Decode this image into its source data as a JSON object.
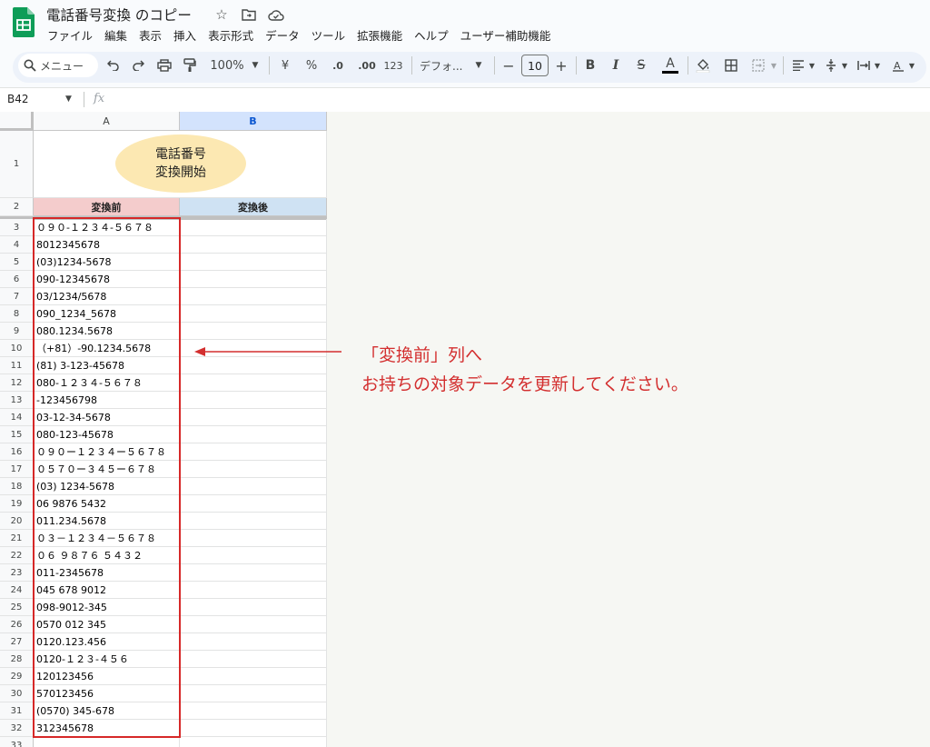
{
  "app": {
    "title": "電話番号変換 のコピー",
    "star_icon": "star-icon",
    "folder_icon": "move-folder-icon",
    "cloud_icon": "cloud-status-icon"
  },
  "menu": [
    "ファイル",
    "編集",
    "表示",
    "挿入",
    "表示形式",
    "データ",
    "ツール",
    "拡張機能",
    "ヘルプ",
    "ユーザー補助機能"
  ],
  "toolbar": {
    "search_label": "メニュー",
    "zoom": "100%",
    "currency": "¥",
    "percent": "%",
    "decrease_decimal": ".0",
    "increase_decimal": ".00",
    "number_format": "123",
    "font": "デフォ...",
    "font_size": "10",
    "minus": "−",
    "plus": "+",
    "bold": "B",
    "italic": "I",
    "strike": "S",
    "text_color": "A"
  },
  "formula_bar": {
    "name_box": "B42",
    "fx": "fx",
    "value": ""
  },
  "columns": [
    "A",
    "B"
  ],
  "header_row": {
    "before": "変換前",
    "after": "変換後"
  },
  "start_button": {
    "line1": "電話番号",
    "line2": "変換開始"
  },
  "rows": [
    {
      "n": "1",
      "a": ""
    },
    {
      "n": "2",
      "a": ""
    },
    {
      "n": "3",
      "a": "０９０-１２３４-５６７８"
    },
    {
      "n": "4",
      "a": "8012345678"
    },
    {
      "n": "5",
      "a": "(03)1234-5678"
    },
    {
      "n": "6",
      "a": "090-12345678"
    },
    {
      "n": "7",
      "a": "03/1234/5678"
    },
    {
      "n": "8",
      "a": "090_1234_5678"
    },
    {
      "n": "9",
      "a": "080.1234.5678"
    },
    {
      "n": "10",
      "a": "（+81）-90.1234.5678"
    },
    {
      "n": "11",
      "a": "(81) 3-123-45678"
    },
    {
      "n": "12",
      "a": "080-１２３４-５６７８"
    },
    {
      "n": "13",
      "a": "-123456798"
    },
    {
      "n": "14",
      "a": "03-12-34-5678"
    },
    {
      "n": "15",
      "a": "080-123-45678"
    },
    {
      "n": "16",
      "a": "０９０ー１２３４ー５６７８"
    },
    {
      "n": "17",
      "a": "０５７０ー３４５ー６７８"
    },
    {
      "n": "18",
      "a": "(03) 1234-5678"
    },
    {
      "n": "19",
      "a": "06 9876 5432"
    },
    {
      "n": "20",
      "a": "011.234.5678"
    },
    {
      "n": "21",
      "a": "０３－１２３４－５６７８"
    },
    {
      "n": "22",
      "a": "０６ ９８７６ ５４３２"
    },
    {
      "n": "23",
      "a": "011-2345678"
    },
    {
      "n": "24",
      "a": "045 678 9012"
    },
    {
      "n": "25",
      "a": "098-9012-345"
    },
    {
      "n": "26",
      "a": "0570 012 345"
    },
    {
      "n": "27",
      "a": "0120.123.456"
    },
    {
      "n": "28",
      "a": "0120-１２３-４５６"
    },
    {
      "n": "29",
      "a": "120123456"
    },
    {
      "n": "30",
      "a": "570123456"
    },
    {
      "n": "31",
      "a": "(0570) 345-678"
    },
    {
      "n": "32",
      "a": "312345678"
    },
    {
      "n": "33",
      "a": ""
    }
  ],
  "annotation": {
    "line1": "「変換前」列へ",
    "line2": "お持ちの対象データを更新してください。"
  },
  "colors": {
    "header_before_bg": "#f4cccc",
    "header_after_bg": "#cfe2f3",
    "button_bg": "#fce8b2",
    "highlight": "#d62828",
    "annotation_text": "#d32f2f"
  }
}
